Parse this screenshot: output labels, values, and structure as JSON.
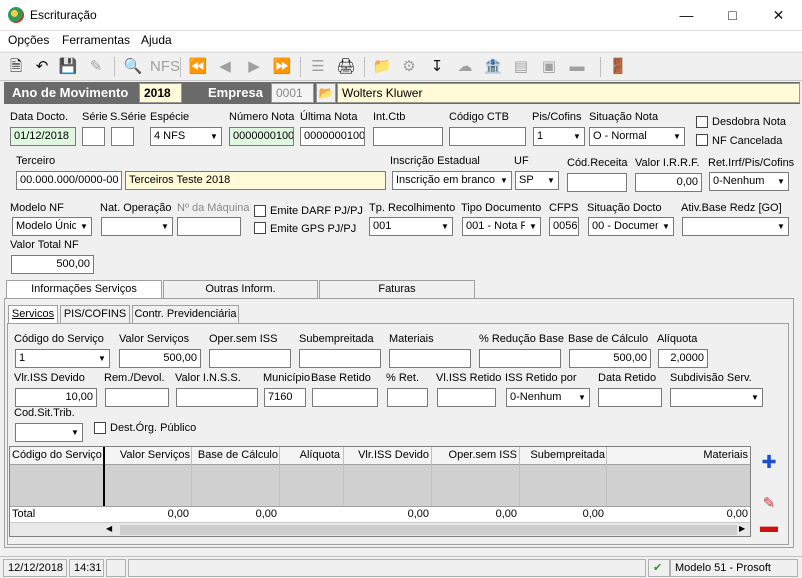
{
  "window": {
    "title": "Escrituração",
    "min_icon": "minimize-icon",
    "max_icon": "maximize-icon",
    "close_icon": "close-icon"
  },
  "menu": [
    "Opções",
    "Ferramentas",
    "Ajuda"
  ],
  "header": {
    "year_label": "Ano de Movimento",
    "year_value": "2018",
    "company_label": "Empresa",
    "company_code": "0001",
    "company_name": "Wolters Kluwer"
  },
  "row1": {
    "data_docto_label": "Data Docto.",
    "data_docto": "01/12/2018",
    "serie_label": "Série",
    "serie": "",
    "sserie_label": "S.Série",
    "sserie": "",
    "especie_label": "Espécie",
    "especie": "4 NFS",
    "numero_nota_label": "Número Nota",
    "numero_nota": "0000000100",
    "ultima_nota_label": "Última Nota",
    "ultima_nota": "0000000100",
    "int_ctb_label": "Int.Ctb",
    "int_ctb": "",
    "codigo_ctb_label": "Código CTB",
    "codigo_ctb": "",
    "pis_cofins_label": "Pis/Cofins",
    "pis_cofins": "1",
    "situacao_nota_label": "Situação Nota",
    "situacao_nota": "O - Normal",
    "desdobra_label": "Desdobra Nota",
    "nf_cancelada_label": "NF Cancelada"
  },
  "row2": {
    "terceiro_label": "Terceiro",
    "terceiro_doc": "00.000.000/0000-00",
    "terceiro_name": "Terceiros Teste 2018",
    "insc_est_label": "Inscrição Estadual",
    "insc_est": "Inscrição em branco",
    "uf_label": "UF",
    "uf": "SP",
    "cod_receita_label": "Cód.Receita",
    "cod_receita": "",
    "valor_irrf_label": "Valor I.R.R.F.",
    "valor_irrf": "0,00",
    "ret_irrf_label": "Ret.Irrf/Pis/Cofins",
    "ret_irrf": "0-Nenhum"
  },
  "row3": {
    "modelo_nf_label": "Modelo NF",
    "modelo_nf": "Modelo Único",
    "nat_oper_label": "Nat. Operação",
    "nat_oper": "",
    "maquina_label": "Nº da Máquina",
    "maquina": "",
    "emite_darf_label": "Emite DARF PJ/PJ",
    "emite_gps_label": "Emite GPS PJ/PJ",
    "tp_recolh_label": "Tp. Recolhimento",
    "tp_recolh": "001",
    "tipo_doc_label": "Tipo Documento",
    "tipo_doc": "001 - Nota F",
    "cfps_label": "CFPS",
    "cfps": "0056",
    "sit_docto_label": "Situação Docto",
    "sit_docto": "00 - Documen",
    "ativ_base_label": "Ativ.Base Redz [GO]",
    "ativ_base": ""
  },
  "row4": {
    "valor_total_label": "Valor Total NF",
    "valor_total": "500,00"
  },
  "tabs": [
    "Informações Serviços",
    "Outras Inform.",
    "Faturas"
  ],
  "subtabs": [
    "Servicos",
    "PIS/COFINS",
    "Contr. Previdenciária"
  ],
  "servicos": {
    "cod_servico_label": "Código do Serviço",
    "cod_servico": "1",
    "valor_servicos_label": "Valor Serviços",
    "valor_servicos": "500,00",
    "oper_sem_iss_label": "Oper.sem ISS",
    "oper_sem_iss": "",
    "subempreitada_label": "Subempreitada",
    "subempreitada": "",
    "materiais_label": "Materiais",
    "materiais": "",
    "reducao_label": "% Redução Base",
    "reducao": "",
    "base_calculo_label": "Base de Cálculo",
    "base_calculo": "500,00",
    "aliquota_label": "Alíquota",
    "aliquota": "2,0000",
    "vlr_iss_label": "Vlr.ISS Devido",
    "vlr_iss": "10,00",
    "rem_devol_label": "Rem./Devol.",
    "rem_devol": "",
    "valor_inss_label": "Valor I.N.S.S.",
    "valor_inss": "",
    "municipio_label": "Município",
    "municipio": "7160",
    "base_retido_label": "Base Retido",
    "base_retido": "",
    "pct_ret_label": "% Ret.",
    "pct_ret": "",
    "vl_iss_retido_label": "Vl.ISS Retido",
    "vl_iss_retido": "",
    "iss_retido_por_label": "ISS Retido por",
    "iss_retido_por": "0-Nenhum",
    "data_retido_label": "Data Retido",
    "data_retido": "",
    "subdivisao_label": "Subdivisão Serv.",
    "subdivisao": "",
    "cod_sit_trib_label": "Cod.Sit.Trib.",
    "cod_sit_trib": "",
    "dest_org_label": "Dest.Órg. Público"
  },
  "grid": {
    "columns": [
      "Código do Serviço",
      "Valor Serviços",
      "Base de Cálculo",
      "Alíquota",
      "Vlr.ISS Devido",
      "Oper.sem ISS",
      "Subempreitada",
      "Materiais"
    ],
    "total_label": "Total",
    "totals": [
      "0,00",
      "0,00",
      "0,00",
      "0,00",
      "0,00",
      "0,00"
    ]
  },
  "status": {
    "date": "12/12/2018",
    "time": "14:31",
    "model": "Modelo 51 - Prosoft"
  }
}
